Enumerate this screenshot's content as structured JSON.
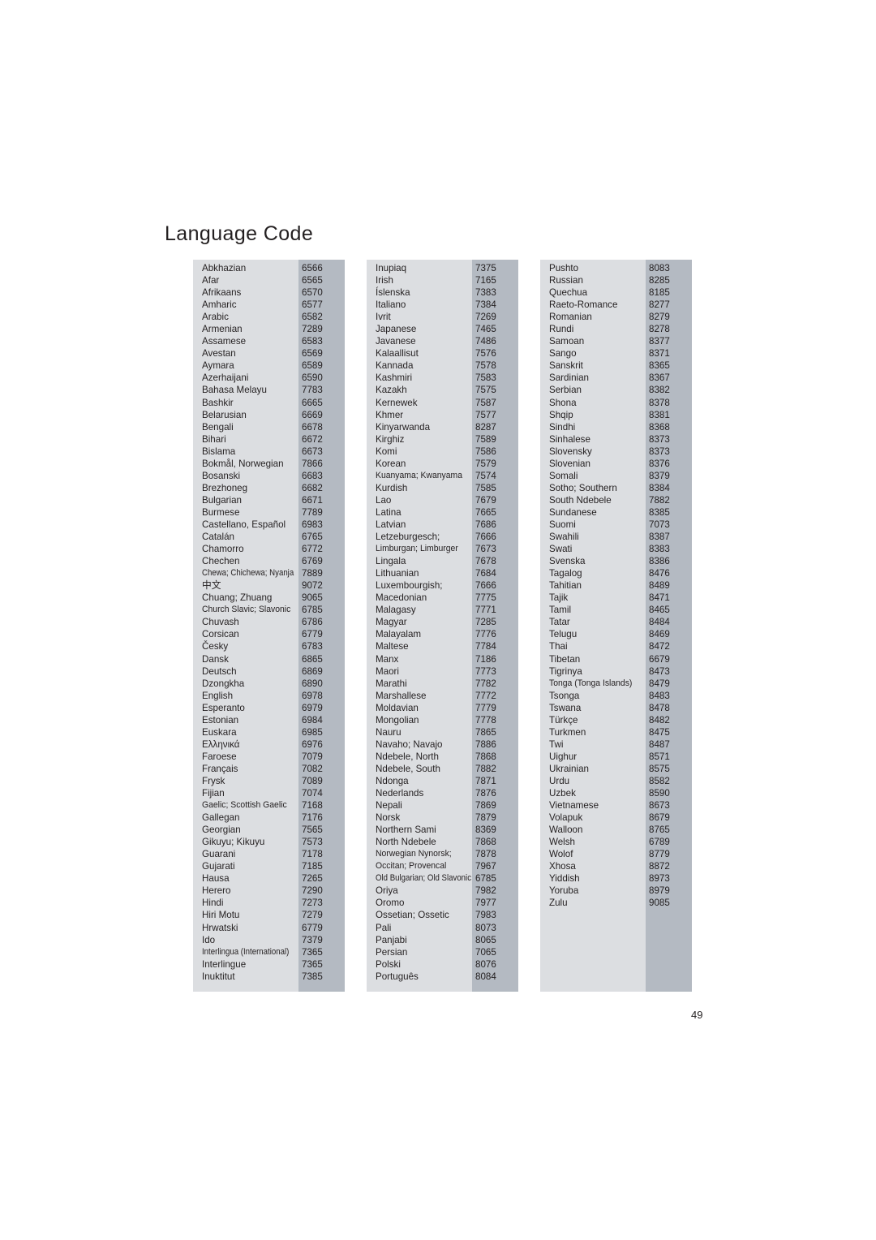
{
  "page": {
    "title": "Language Code",
    "page_number": "49",
    "colors": {
      "name_column_bg": "#dcdee1",
      "code_column_bg": "#b4bac2",
      "text": "#231f20",
      "page_bg": "#ffffff"
    }
  },
  "columns": [
    {
      "id": "column-1",
      "rows": [
        {
          "name": "Abkhazian",
          "code": "6566"
        },
        {
          "name": "Afar",
          "code": "6565"
        },
        {
          "name": "Afrikaans",
          "code": "6570"
        },
        {
          "name": "Amharic",
          "code": "6577"
        },
        {
          "name": "Arabic",
          "code": "6582"
        },
        {
          "name": "Armenian",
          "code": "7289"
        },
        {
          "name": "Assamese",
          "code": "6583"
        },
        {
          "name": "Avestan",
          "code": "6569"
        },
        {
          "name": "Aymara",
          "code": "6589"
        },
        {
          "name": "Azerhaijani",
          "code": "6590"
        },
        {
          "name": "Bahasa Melayu",
          "code": "7783"
        },
        {
          "name": "Bashkir",
          "code": "6665"
        },
        {
          "name": "Belarusian",
          "code": "6669"
        },
        {
          "name": "Bengali",
          "code": "6678"
        },
        {
          "name": "Bihari",
          "code": "6672"
        },
        {
          "name": "Bislama",
          "code": "6673"
        },
        {
          "name": "Bokmål, Norwegian",
          "code": "7866"
        },
        {
          "name": "Bosanski",
          "code": "6683"
        },
        {
          "name": "Brezhoneg",
          "code": "6682"
        },
        {
          "name": "Bulgarian",
          "code": "6671"
        },
        {
          "name": "Burmese",
          "code": "7789"
        },
        {
          "name": "Castellano, Español",
          "code": "6983"
        },
        {
          "name": "Catalán",
          "code": "6765"
        },
        {
          "name": "Chamorro",
          "code": "6772"
        },
        {
          "name": "Chechen",
          "code": "6769"
        },
        {
          "name": "Chewa; Chichewa; Nyanja",
          "code": "7889",
          "fit": "squeeze"
        },
        {
          "name": "中文",
          "code": "9072",
          "script": "cjk"
        },
        {
          "name": "Chuang; Zhuang",
          "code": "9065"
        },
        {
          "name": "Church Slavic; Slavonic",
          "code": "6785",
          "fit": "squeeze2"
        },
        {
          "name": "Chuvash",
          "code": "6786"
        },
        {
          "name": "Corsican",
          "code": "6779"
        },
        {
          "name": "Česky",
          "code": "6783"
        },
        {
          "name": "Dansk",
          "code": "6865"
        },
        {
          "name": "Deutsch",
          "code": "6869"
        },
        {
          "name": "Dzongkha",
          "code": "6890"
        },
        {
          "name": "English",
          "code": "6978"
        },
        {
          "name": "Esperanto",
          "code": "6979"
        },
        {
          "name": "Estonian",
          "code": "6984"
        },
        {
          "name": "Euskara",
          "code": "6985"
        },
        {
          "name": "Ελληνικά",
          "code": "6976"
        },
        {
          "name": "Faroese",
          "code": "7079"
        },
        {
          "name": "Français",
          "code": "7082"
        },
        {
          "name": "Frysk",
          "code": "7089"
        },
        {
          "name": "Fijian",
          "code": "7074"
        },
        {
          "name": "Gaelic; Scottish Gaelic",
          "code": "7168",
          "fit": "squeeze2"
        },
        {
          "name": "Gallegan",
          "code": "7176"
        },
        {
          "name": "Georgian",
          "code": "7565"
        },
        {
          "name": "Gikuyu; Kikuyu",
          "code": "7573"
        },
        {
          "name": "Guarani",
          "code": "7178"
        },
        {
          "name": "Gujarati",
          "code": "7185"
        },
        {
          "name": "Hausa",
          "code": "7265"
        },
        {
          "name": "Herero",
          "code": "7290"
        },
        {
          "name": "Hindi",
          "code": "7273"
        },
        {
          "name": "Hiri Motu",
          "code": "7279"
        },
        {
          "name": "Hrwatski",
          "code": "6779"
        },
        {
          "name": "Ido",
          "code": "7379"
        },
        {
          "name": "Interlingua (International)",
          "code": "7365",
          "fit": "squeeze"
        },
        {
          "name": "Interlingue",
          "code": "7365"
        },
        {
          "name": "Inuktitut",
          "code": "7385"
        }
      ]
    },
    {
      "id": "column-2",
      "rows": [
        {
          "name": "Inupiaq",
          "code": "7375"
        },
        {
          "name": "Irish",
          "code": "7165"
        },
        {
          "name": "Íslenska",
          "code": "7383"
        },
        {
          "name": "Italiano",
          "code": "7384"
        },
        {
          "name": "Ivrit",
          "code": "7269"
        },
        {
          "name": "Japanese",
          "code": "7465"
        },
        {
          "name": "Javanese",
          "code": "7486"
        },
        {
          "name": "Kalaallisut",
          "code": "7576"
        },
        {
          "name": "Kannada",
          "code": "7578"
        },
        {
          "name": "Kashmiri",
          "code": "7583"
        },
        {
          "name": "Kazakh",
          "code": "7575"
        },
        {
          "name": "Kernewek",
          "code": "7587"
        },
        {
          "name": "Khmer",
          "code": "7577"
        },
        {
          "name": "Kinyarwanda",
          "code": "8287"
        },
        {
          "name": "Kirghiz",
          "code": "7589"
        },
        {
          "name": "Komi",
          "code": "7586"
        },
        {
          "name": "Korean",
          "code": "7579"
        },
        {
          "name": "Kuanyama; Kwanyama",
          "code": "7574",
          "fit": "squeeze2"
        },
        {
          "name": "Kurdish",
          "code": "7585"
        },
        {
          "name": "Lao",
          "code": "7679"
        },
        {
          "name": "Latina",
          "code": "7665"
        },
        {
          "name": "Latvian",
          "code": "7686"
        },
        {
          "name": "Letzeburgesch;",
          "code": "7666"
        },
        {
          "name": "Limburgan; Limburger",
          "code": "7673",
          "fit": "squeeze2"
        },
        {
          "name": "Lingala",
          "code": "7678"
        },
        {
          "name": "Lithuanian",
          "code": "7684"
        },
        {
          "name": "Luxembourgish;",
          "code": "7666"
        },
        {
          "name": "Macedonian",
          "code": "7775"
        },
        {
          "name": "Malagasy",
          "code": "7771"
        },
        {
          "name": "Magyar",
          "code": "7285"
        },
        {
          "name": "Malayalam",
          "code": "7776"
        },
        {
          "name": "Maltese",
          "code": "7784"
        },
        {
          "name": "Manx",
          "code": "7186"
        },
        {
          "name": "Maori",
          "code": "7773"
        },
        {
          "name": "Marathi",
          "code": "7782"
        },
        {
          "name": "Marshallese",
          "code": "7772"
        },
        {
          "name": "Moldavian",
          "code": "7779"
        },
        {
          "name": "Mongolian",
          "code": "7778"
        },
        {
          "name": "Nauru",
          "code": "7865"
        },
        {
          "name": "Navaho; Navajo",
          "code": "7886"
        },
        {
          "name": "Ndebele, North",
          "code": "7868"
        },
        {
          "name": "Ndebele, South",
          "code": "7882"
        },
        {
          "name": "Ndonga",
          "code": "7871"
        },
        {
          "name": "Nederlands",
          "code": "7876"
        },
        {
          "name": "Nepali",
          "code": "7869"
        },
        {
          "name": "Norsk",
          "code": "7879"
        },
        {
          "name": "Northern Sami",
          "code": "8369"
        },
        {
          "name": "North Ndebele",
          "code": "7868"
        },
        {
          "name": "Norwegian Nynorsk;",
          "code": "7878",
          "fit": "squeeze2"
        },
        {
          "name": "Occitan; Provencal",
          "code": "7967",
          "fit": "squeeze2"
        },
        {
          "name": "Old Bulgarian; Old Slavonic",
          "code": "6785",
          "fit": "squeeze"
        },
        {
          "name": "Oriya",
          "code": "7982"
        },
        {
          "name": "Oromo",
          "code": "7977"
        },
        {
          "name": "Ossetian; Ossetic",
          "code": "7983"
        },
        {
          "name": "Pali",
          "code": "8073"
        },
        {
          "name": "Panjabi",
          "code": "8065"
        },
        {
          "name": "Persian",
          "code": "7065"
        },
        {
          "name": "Polski",
          "code": "8076"
        },
        {
          "name": "Português",
          "code": "8084"
        }
      ]
    },
    {
      "id": "column-3",
      "rows": [
        {
          "name": "Pushto",
          "code": "8083"
        },
        {
          "name": "Russian",
          "code": "8285"
        },
        {
          "name": "Quechua",
          "code": "8185"
        },
        {
          "name": "Raeto-Romance",
          "code": "8277"
        },
        {
          "name": "Romanian",
          "code": "8279"
        },
        {
          "name": "Rundi",
          "code": "8278"
        },
        {
          "name": "Samoan",
          "code": "8377"
        },
        {
          "name": "Sango",
          "code": "8371"
        },
        {
          "name": "Sanskrit",
          "code": "8365"
        },
        {
          "name": "Sardinian",
          "code": "8367"
        },
        {
          "name": "Serbian",
          "code": "8382"
        },
        {
          "name": "Shona",
          "code": "8378"
        },
        {
          "name": "Shqip",
          "code": "8381"
        },
        {
          "name": "Sindhi",
          "code": "8368"
        },
        {
          "name": "Sinhalese",
          "code": "8373"
        },
        {
          "name": "Slovensky",
          "code": "8373"
        },
        {
          "name": "Slovenian",
          "code": "8376"
        },
        {
          "name": "Somali",
          "code": "8379"
        },
        {
          "name": "Sotho; Southern",
          "code": "8384"
        },
        {
          "name": "South Ndebele",
          "code": "7882"
        },
        {
          "name": "Sundanese",
          "code": "8385"
        },
        {
          "name": "Suomi",
          "code": "7073"
        },
        {
          "name": "Swahili",
          "code": "8387"
        },
        {
          "name": "Swati",
          "code": "8383"
        },
        {
          "name": "Svenska",
          "code": "8386"
        },
        {
          "name": "Tagalog",
          "code": "8476"
        },
        {
          "name": "Tahitian",
          "code": "8489"
        },
        {
          "name": "Tajik",
          "code": "8471"
        },
        {
          "name": "Tamil",
          "code": "8465"
        },
        {
          "name": "Tatar",
          "code": "8484"
        },
        {
          "name": "Telugu",
          "code": "8469"
        },
        {
          "name": "Thai",
          "code": "8472"
        },
        {
          "name": "Tibetan",
          "code": "6679"
        },
        {
          "name": "Tigrinya",
          "code": "8473"
        },
        {
          "name": "Tonga (Tonga Islands)",
          "code": "8479",
          "fit": "squeeze2"
        },
        {
          "name": "Tsonga",
          "code": "8483"
        },
        {
          "name": "Tswana",
          "code": "8478"
        },
        {
          "name": "Türkçe",
          "code": "8482"
        },
        {
          "name": "Turkmen",
          "code": "8475"
        },
        {
          "name": "Twi",
          "code": "8487"
        },
        {
          "name": "Uighur",
          "code": "8571"
        },
        {
          "name": "Ukrainian",
          "code": "8575"
        },
        {
          "name": "Urdu",
          "code": "8582"
        },
        {
          "name": "Uzbek",
          "code": "8590"
        },
        {
          "name": "Vietnamese",
          "code": "8673"
        },
        {
          "name": "Volapuk",
          "code": "8679"
        },
        {
          "name": "Walloon",
          "code": "8765"
        },
        {
          "name": "Welsh",
          "code": "6789"
        },
        {
          "name": "Wolof",
          "code": "8779"
        },
        {
          "name": "Xhosa",
          "code": "8872"
        },
        {
          "name": "Yiddish",
          "code": "8973"
        },
        {
          "name": "Yoruba",
          "code": "8979"
        },
        {
          "name": "Zulu",
          "code": "9085"
        }
      ]
    }
  ]
}
